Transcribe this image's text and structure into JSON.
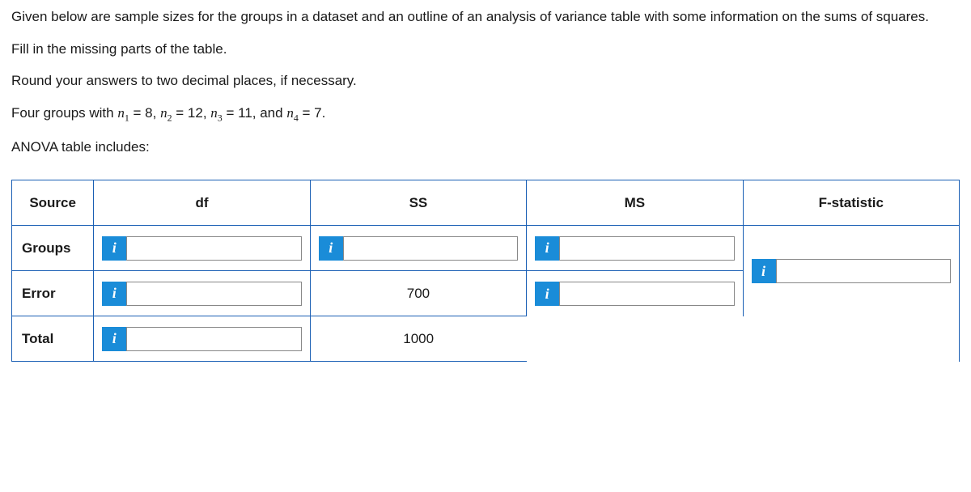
{
  "intro": "Given below are sample sizes for the groups in a dataset and an outline of an analysis of variance table with some information on the sums of squares.",
  "instruction1": "Fill in the missing parts of the table.",
  "instruction2": "Round your answers to two decimal places, if necessary.",
  "groups_prefix": "Four groups with ",
  "anova_label": "ANOVA table includes:",
  "n_values": {
    "n1": "8",
    "n2": "12",
    "n3": "11",
    "n4": "7"
  },
  "info_char": "i",
  "table": {
    "headers": {
      "source": "Source",
      "df": "df",
      "ss": "SS",
      "ms": "MS",
      "f": "F-statistic"
    },
    "rows": {
      "groups": {
        "label": "Groups",
        "df": "",
        "ss": "",
        "ms": ""
      },
      "error": {
        "label": "Error",
        "df": "",
        "ss": "700",
        "ms": ""
      },
      "total": {
        "label": "Total",
        "df": "",
        "ss": "1000"
      },
      "f": ""
    }
  }
}
